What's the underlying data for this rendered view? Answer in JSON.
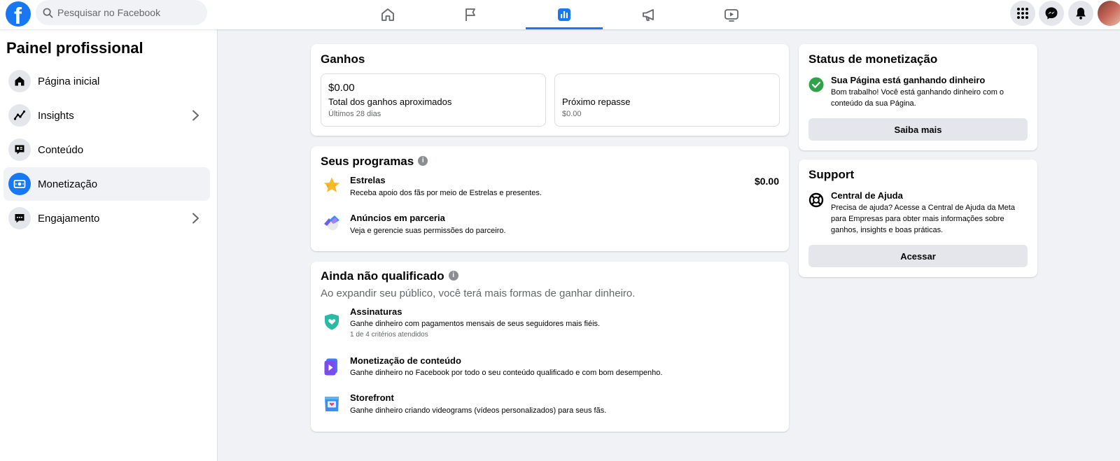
{
  "topbar": {
    "logo_letter": "f",
    "search_placeholder": "Pesquisar no Facebook",
    "nav_tabs": [
      "home-icon",
      "flag-icon",
      "chart-icon",
      "megaphone-icon",
      "video-icon"
    ],
    "active_tab": 2
  },
  "sidebar": {
    "title": "Painel profissional",
    "items": [
      {
        "label": "Página inicial",
        "icon": "home-icon",
        "chevron": false
      },
      {
        "label": "Insights",
        "icon": "insights-icon",
        "chevron": true
      },
      {
        "label": "Conteúdo",
        "icon": "content-icon",
        "chevron": false
      },
      {
        "label": "Monetização",
        "icon": "monetization-icon",
        "chevron": false,
        "active": true
      },
      {
        "label": "Engajamento",
        "icon": "chat-icon",
        "chevron": true
      }
    ]
  },
  "earnings": {
    "title": "Ganhos",
    "total_value": "$0.00",
    "total_label": "Total dos ganhos aproximados",
    "total_period": "Últimos 28 dias",
    "payout_label": "Próximo repasse",
    "payout_value": "$0.00"
  },
  "programs": {
    "title": "Seus programas",
    "items": [
      {
        "name": "Estrelas",
        "desc": "Receba apoio dos fãs por meio de Estrelas e presentes.",
        "value": "$0.00"
      },
      {
        "name": "Anúncios em parceria",
        "desc": "Veja e gerencie suas permissões do parceiro."
      }
    ]
  },
  "not_qualified": {
    "title": "Ainda não qualificado",
    "subtitle": "Ao expandir seu público, você terá mais formas de ganhar dinheiro.",
    "items": [
      {
        "name": "Assinaturas",
        "desc": "Ganhe dinheiro com pagamentos mensais de seus seguidores mais fiéis.",
        "meta": "1 de 4 critérios atendidos"
      },
      {
        "name": "Monetização de conteúdo",
        "desc": "Ganhe dinheiro no Facebook por todo o seu conteúdo qualificado e com bom desempenho."
      },
      {
        "name": "Storefront",
        "desc": "Ganhe dinheiro criando videograms (vídeos personalizados) para seus fãs."
      }
    ]
  },
  "status": {
    "title": "Status de monetização",
    "headline": "Sua Página está ganhando dinheiro",
    "body_line1": "Bom trabalho! Você está ganhando dinheiro com o",
    "body_line2": "conteúdo da sua Página.",
    "button": "Saiba mais"
  },
  "support": {
    "title": "Support",
    "headline": "Central de Ajuda",
    "body_line1": "Precisa de ajuda? Acesse a Central de Ajuda da Meta",
    "body_line2": "para Empresas para obter mais informações sobre",
    "body_line3": "ganhos, insights e boas práticas.",
    "button": "Acessar"
  },
  "colors": {
    "brand": "#1877f2",
    "success": "#31a24c",
    "background": "#f0f2f5"
  }
}
